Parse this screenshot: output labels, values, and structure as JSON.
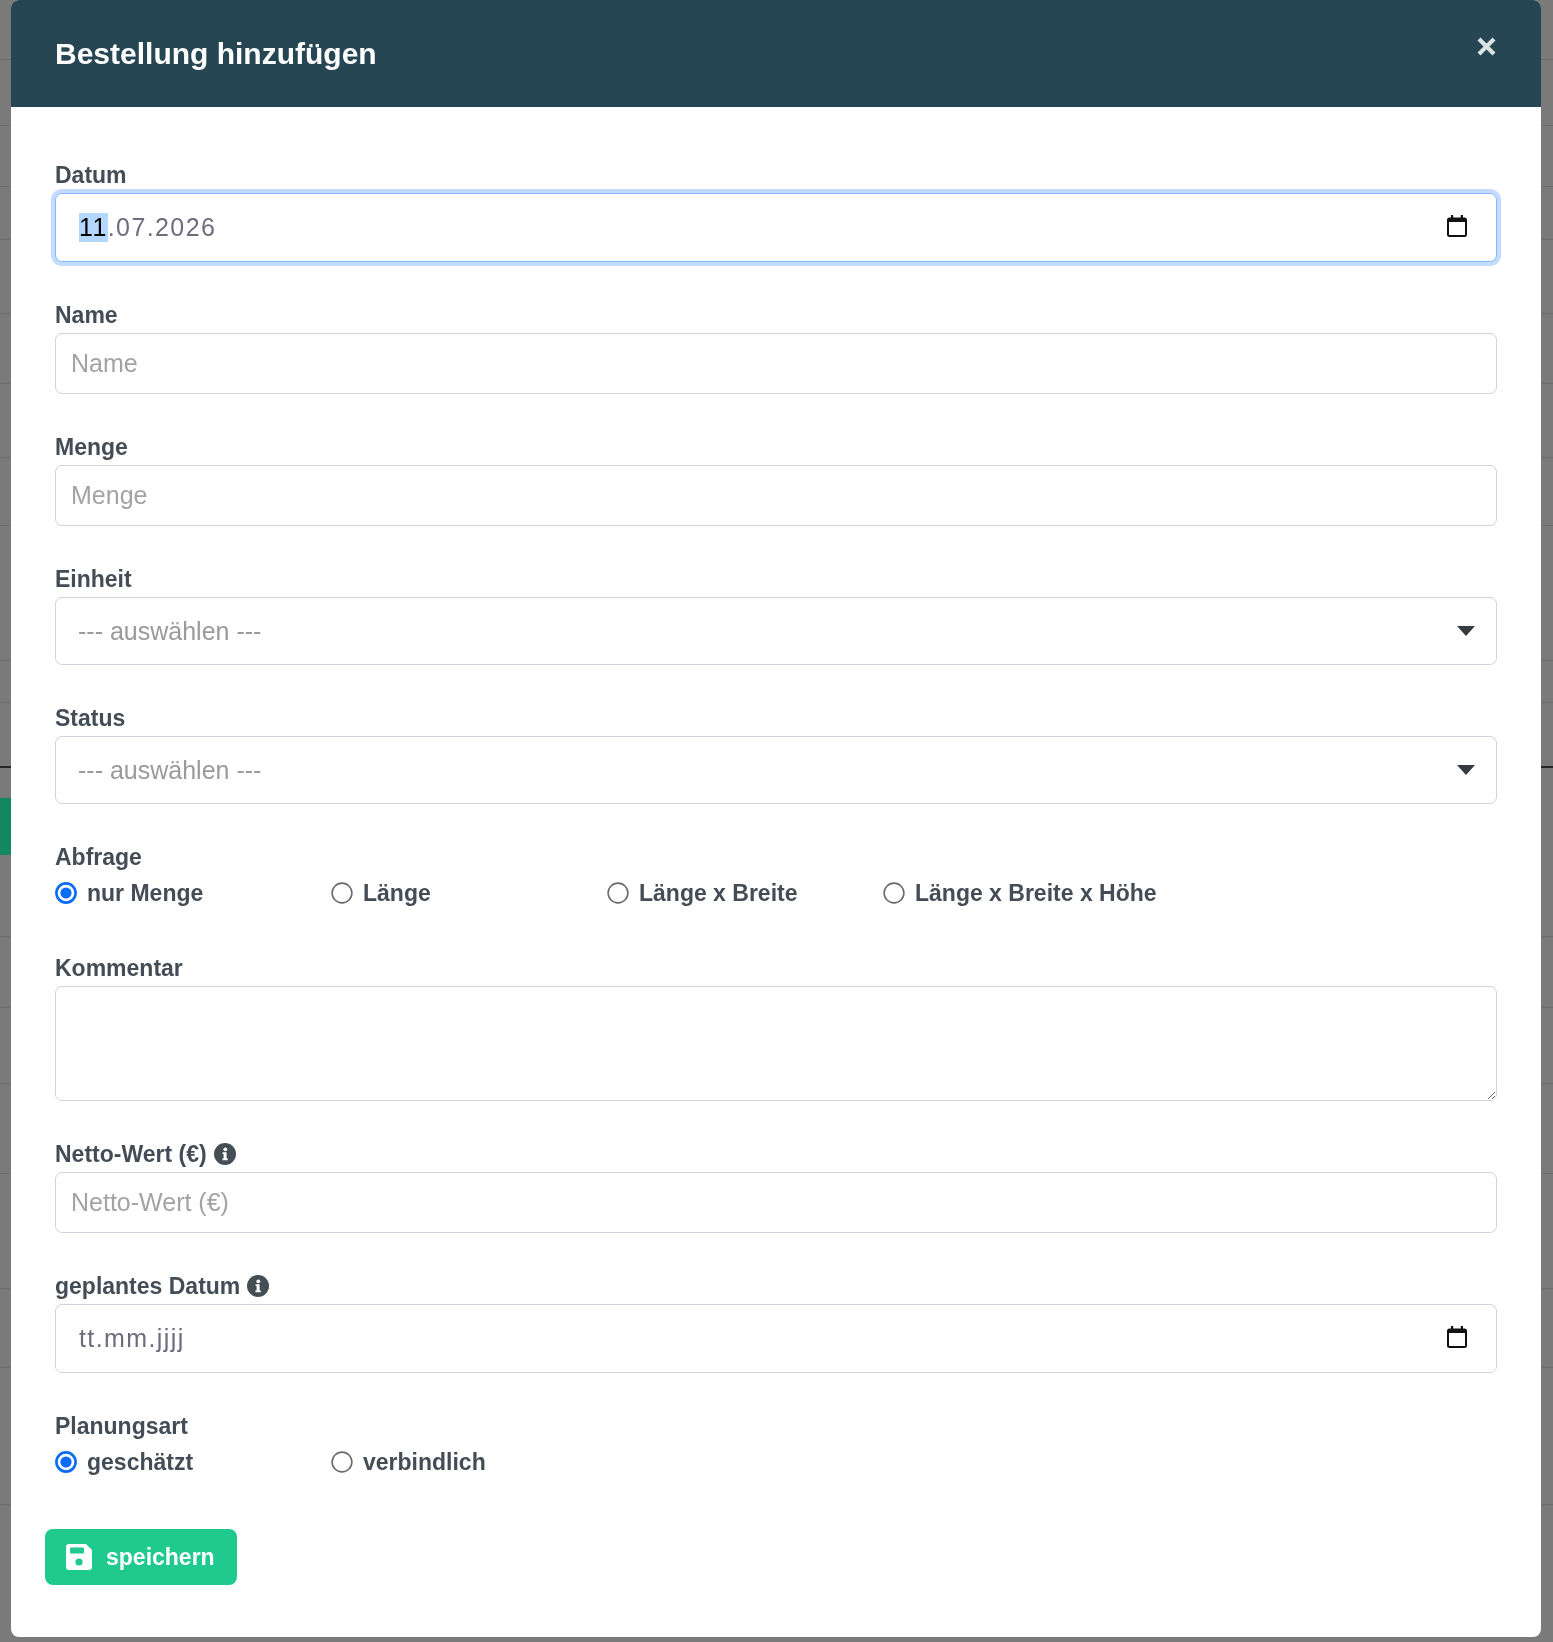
{
  "modal": {
    "title": "Bestellung hinzufügen"
  },
  "fields": [
    {
      "kind": "date",
      "label": "Datum",
      "info": false,
      "focused": true,
      "value_parts": [
        {
          "text": "11",
          "selected": true
        },
        {
          "text": ".07.2026",
          "selected": false
        }
      ]
    },
    {
      "kind": "text",
      "label": "Name",
      "info": false,
      "focused": false,
      "placeholder": "Name"
    },
    {
      "kind": "text",
      "label": "Menge",
      "info": false,
      "focused": false,
      "placeholder": "Menge"
    },
    {
      "kind": "select",
      "label": "Einheit",
      "info": false,
      "focused": false,
      "value": "--- auswählen ---"
    },
    {
      "kind": "select",
      "label": "Status",
      "info": false,
      "focused": false,
      "value": "--- auswählen ---"
    },
    {
      "kind": "radio",
      "label": "Abfrage",
      "info": false,
      "options": [
        {
          "label": "nur Menge",
          "selected": true
        },
        {
          "label": "Länge",
          "selected": false
        },
        {
          "label": "Länge x Breite",
          "selected": false
        },
        {
          "label": "Länge x Breite x Höhe",
          "selected": false
        }
      ]
    },
    {
      "kind": "textarea",
      "label": "Kommentar",
      "info": false,
      "focused": false
    },
    {
      "kind": "text",
      "label": "Netto-Wert (€)",
      "info": true,
      "focused": false,
      "placeholder": "Netto-Wert (€)"
    },
    {
      "kind": "date",
      "label": "geplantes Datum",
      "info": true,
      "focused": false,
      "placeholder": "tt.mm.jjjj"
    },
    {
      "kind": "radio",
      "label": "Planungsart",
      "info": false,
      "options": [
        {
          "label": "geschätzt",
          "selected": true
        },
        {
          "label": "verbindlich",
          "selected": false
        }
      ]
    }
  ],
  "save_button": {
    "label": "speichern"
  }
}
